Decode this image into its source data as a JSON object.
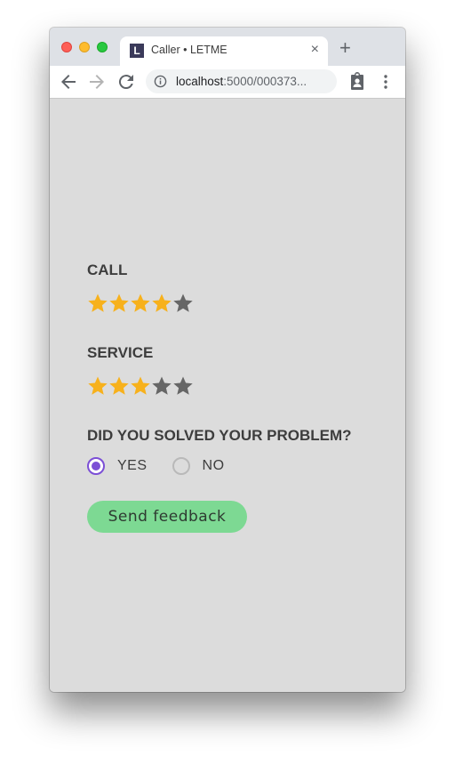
{
  "browser": {
    "tab": {
      "favicon_letter": "L",
      "title": "Caller • LETME",
      "close_glyph": "×"
    },
    "new_tab_glyph": "+",
    "url": {
      "host": "localhost",
      "rest": ":5000/000373..."
    }
  },
  "form": {
    "call": {
      "label": "CALL",
      "rating": 4,
      "max": 5
    },
    "service": {
      "label": "SERVICE",
      "rating": 3,
      "max": 5
    },
    "problem": {
      "label": "DID YOU SOLVED YOUR PROBLEM?",
      "options": [
        {
          "label": "YES",
          "selected": true
        },
        {
          "label": "NO",
          "selected": false
        }
      ]
    },
    "submit_label": "Send feedback"
  },
  "colors": {
    "star_filled": "#f7b11c",
    "star_empty": "#666666",
    "radio_accent": "#7c4fd6",
    "button_bg": "#7dd993"
  }
}
